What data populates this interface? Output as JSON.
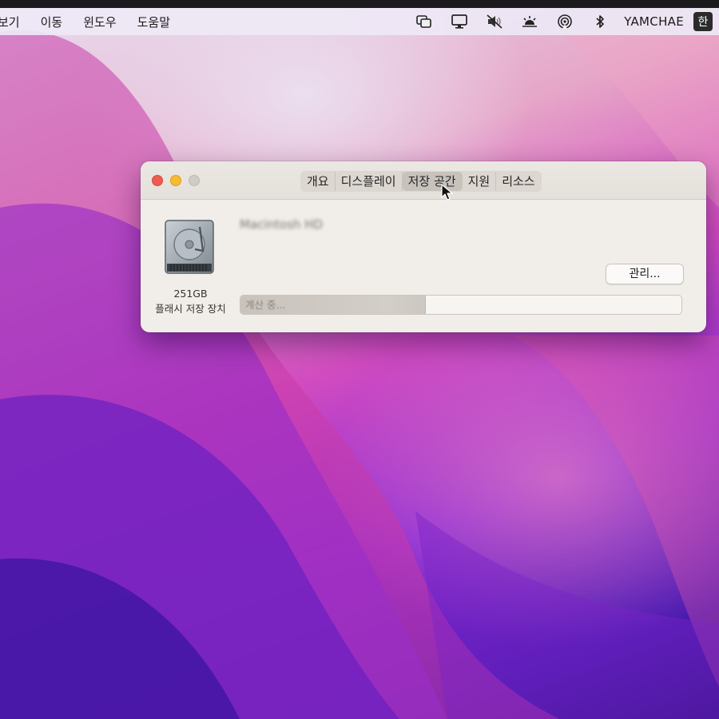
{
  "menubar": {
    "items": [
      "보기",
      "이동",
      "윈도우",
      "도움말"
    ],
    "status_icons": [
      "stage-manager-icon",
      "display-icon",
      "sound-muted-icon",
      "brightness-icon",
      "airdrop-icon",
      "bluetooth-icon"
    ],
    "username": "YAMCHAE",
    "input_source": "한"
  },
  "window": {
    "tabs": [
      "개요",
      "디스플레이",
      "저장 공간",
      "지원",
      "리소스"
    ],
    "active_tab": "저장 공간",
    "disk": {
      "size": "251GB",
      "type": "플래시 저장 장치",
      "volume_name": "Macintosh HD",
      "status": "계산 중...",
      "usage_fraction": 0.42
    },
    "manage_label": "관리..."
  },
  "colors": {
    "close": "#ee5b52",
    "minimize": "#f4bb33",
    "zoom_disabled": "#cfcbc6",
    "window_bg": "#f1ede8"
  }
}
